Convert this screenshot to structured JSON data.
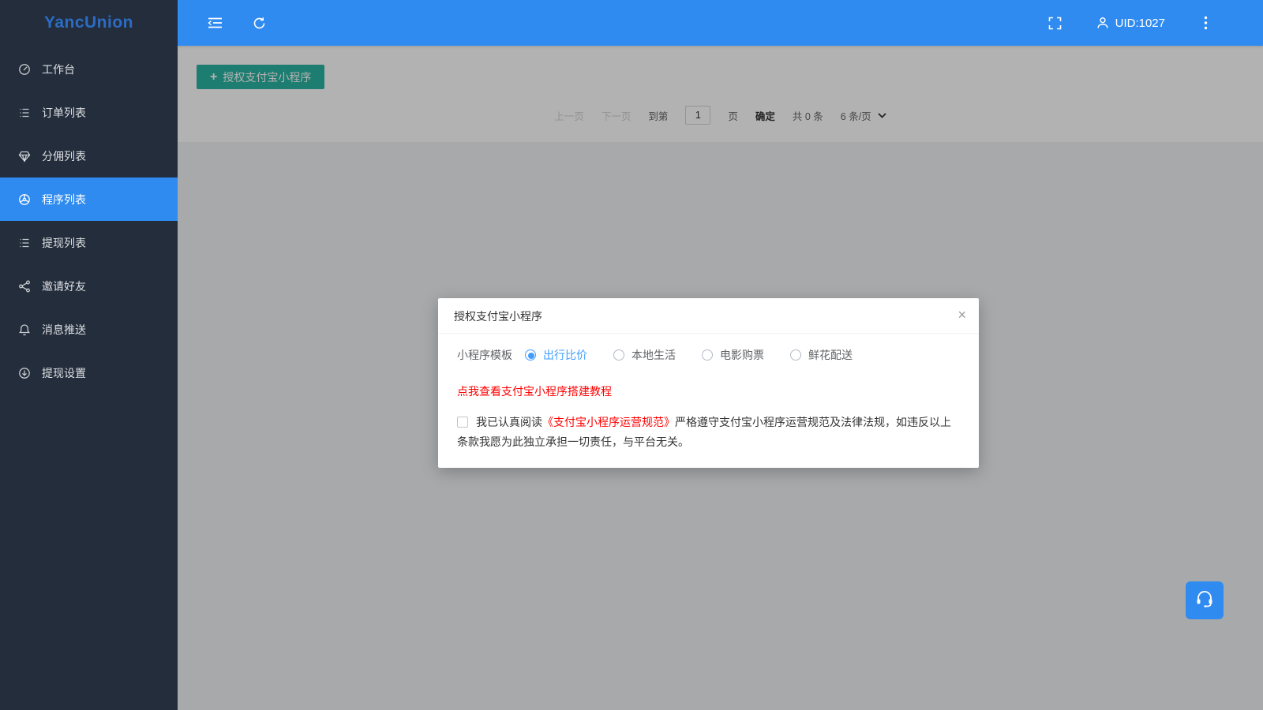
{
  "app": {
    "logo": "YancUnion"
  },
  "colors": {
    "accent_blue": "#2f8bf0",
    "radio_blue": "#409eff",
    "sidebar_bg": "#232d3c",
    "button_teal": "#2bb3a3",
    "link_red": "#ff0000"
  },
  "sidebar": {
    "items": [
      {
        "label": "工作台",
        "icon": "workbench-icon"
      },
      {
        "label": "订单列表",
        "icon": "order-list-icon"
      },
      {
        "label": "分佣列表",
        "icon": "commission-list-icon"
      },
      {
        "label": "程序列表",
        "icon": "program-list-icon",
        "active": true
      },
      {
        "label": "提现列表",
        "icon": "withdraw-list-icon"
      },
      {
        "label": "邀请好友",
        "icon": "invite-friends-icon"
      },
      {
        "label": "消息推送",
        "icon": "message-push-icon"
      },
      {
        "label": "提现设置",
        "icon": "withdraw-settings-icon"
      }
    ]
  },
  "topbar": {
    "uid": "UID:1027"
  },
  "content": {
    "authorize_button": {
      "plus": "+",
      "label": "授权支付宝小程序"
    },
    "pagination": {
      "prev": "上一页",
      "next": "下一页",
      "goto_label": "到第",
      "page_value": "1",
      "page_unit": "页",
      "confirm": "确定",
      "total": "共 0 条",
      "per_page": "6 条/页"
    }
  },
  "modal": {
    "title": "授权支付宝小程序",
    "close": "×",
    "template_label": "小程序模板",
    "options": [
      {
        "label": "出行比价",
        "selected": true
      },
      {
        "label": "本地生活",
        "selected": false
      },
      {
        "label": "电影购票",
        "selected": false
      },
      {
        "label": "鲜花配送",
        "selected": false
      }
    ],
    "tutorial_link": "点我查看支付宝小程序搭建教程",
    "agreement_prefix": "我已认真阅读",
    "agreement_link": "《支付宝小程序运营规范》",
    "agreement_suffix": "严格遵守支付宝小程序运营规范及法律法规，如违反以上条款我愿为此独立承担一切责任，与平台无关。"
  }
}
